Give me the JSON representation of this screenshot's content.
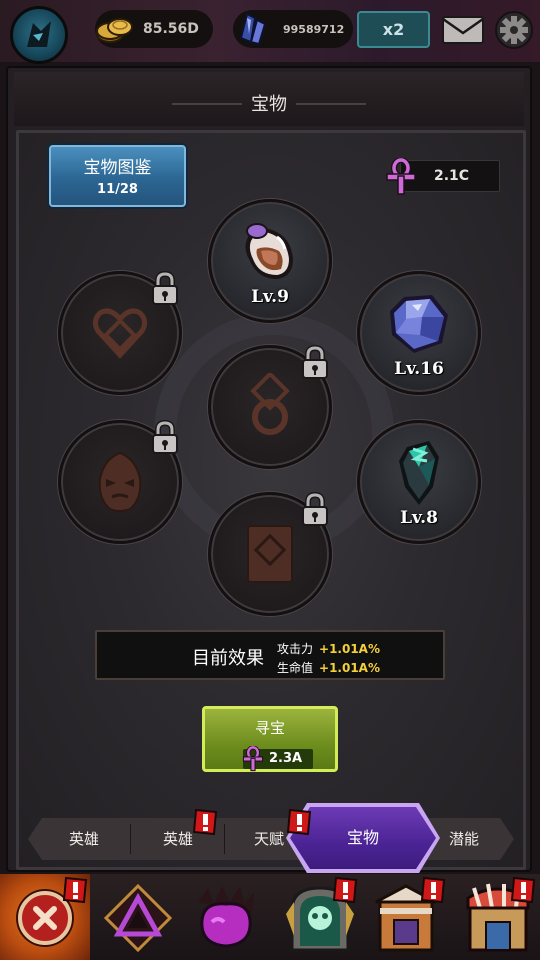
{
  "topbar": {
    "gold": "85.56D",
    "crystals": "99589712",
    "speed_multiplier": "x2",
    "icons": [
      "hero-avatar-icon",
      "gold-coins-icon",
      "crystal-icon",
      "mail-icon",
      "gear-icon"
    ]
  },
  "panel": {
    "title": "宝物",
    "codex": {
      "label": "宝物图鉴",
      "count": "11/28"
    },
    "ankh_currency": "2.1C"
  },
  "slots": [
    {
      "id": "slot-potion",
      "state": "unlocked",
      "icon": "potion-egg-icon",
      "level": "Lv.9"
    },
    {
      "id": "slot-heart",
      "state": "locked",
      "icon": "heart-emblem-icon"
    },
    {
      "id": "slot-gem",
      "state": "unlocked",
      "icon": "blue-gem-icon",
      "level": "Lv.16"
    },
    {
      "id": "slot-ring",
      "state": "locked",
      "icon": "ring-icon"
    },
    {
      "id": "slot-mask",
      "state": "locked",
      "icon": "demon-mask-icon"
    },
    {
      "id": "slot-crystal",
      "state": "unlocked",
      "icon": "dark-crystal-icon",
      "level": "Lv.8"
    },
    {
      "id": "slot-book",
      "state": "locked",
      "icon": "book-icon"
    }
  ],
  "effect": {
    "label": "目前效果",
    "rows": [
      {
        "stat": "攻击力",
        "value": "+1.01A%"
      },
      {
        "stat": "生命值",
        "value": "+1.01A%"
      }
    ]
  },
  "search": {
    "label": "寻宝",
    "cost": "2.3A"
  },
  "tabs": [
    {
      "label": "英雄",
      "badge": false
    },
    {
      "label": "英雄",
      "badge": true
    },
    {
      "label": "天赋",
      "badge": true
    },
    {
      "label": "宝物",
      "badge": false,
      "active": true
    },
    {
      "label": "潜能",
      "badge": false
    }
  ],
  "bottom_nav": [
    {
      "name": "close",
      "icon": "close-icon",
      "badge": true
    },
    {
      "name": "emblem",
      "icon": "triangle-emblem-icon",
      "badge": false
    },
    {
      "name": "paw",
      "icon": "paw-icon",
      "badge": false
    },
    {
      "name": "skull-portal",
      "icon": "skull-portal-icon",
      "badge": true
    },
    {
      "name": "tower",
      "icon": "tower-icon",
      "badge": true
    },
    {
      "name": "shop",
      "icon": "shop-icon",
      "badge": true
    }
  ],
  "colors": {
    "accent_purple": "#5a2aa4",
    "codex_blue": "#2c6693",
    "search_green": "#6d8d1d",
    "effect_yellow": "#f4d03a",
    "badge_red": "#d01818"
  }
}
